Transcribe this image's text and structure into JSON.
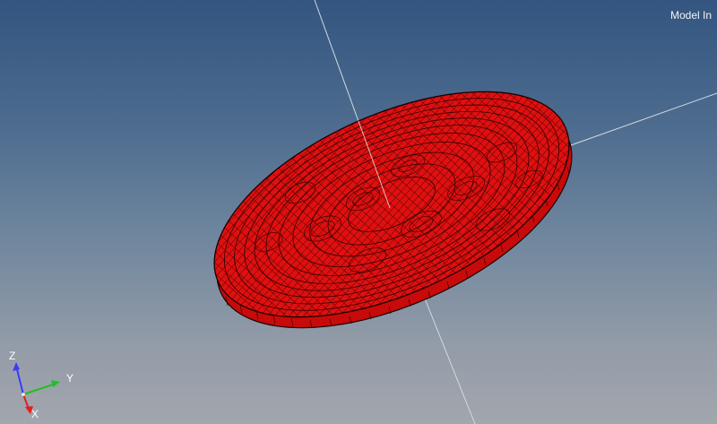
{
  "viewport": {
    "overlay_text": "Model In",
    "background_top": "#33557f",
    "background_bottom": "#a2a6ad"
  },
  "model": {
    "shape": "disc",
    "element_color": "#e01010",
    "edge_color": "#1a0000"
  },
  "triad": {
    "z_label": "Z",
    "y_label": "Y",
    "x_label": "X",
    "z_color": "#3a3aff",
    "y_color": "#22c022",
    "x_color": "#e02020"
  }
}
